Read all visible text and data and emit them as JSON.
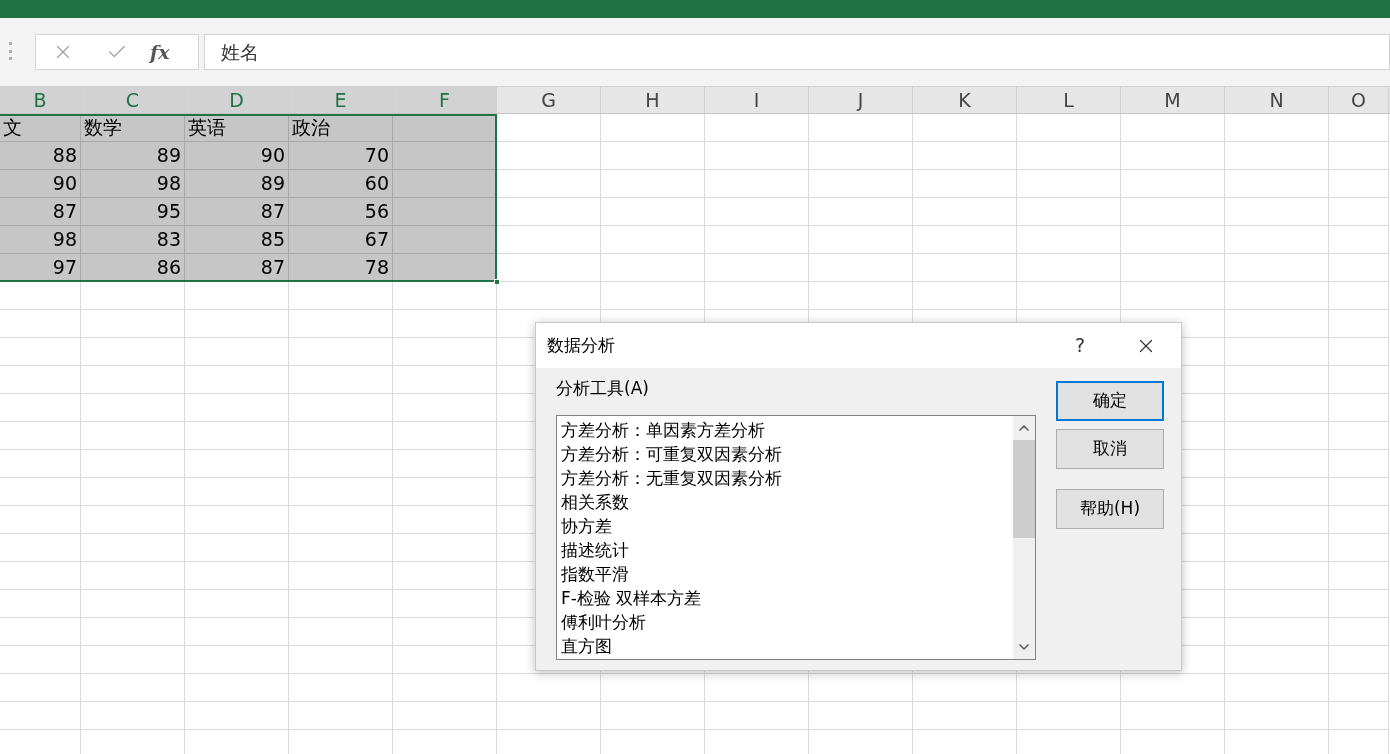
{
  "formula_bar": {
    "fx_label": "fx",
    "value": "姓名"
  },
  "sheet": {
    "columns": [
      {
        "label": "B",
        "selected": true
      },
      {
        "label": "C",
        "selected": true
      },
      {
        "label": "D",
        "selected": true
      },
      {
        "label": "E",
        "selected": true
      },
      {
        "label": "F",
        "selected": true
      },
      {
        "label": "G",
        "selected": false
      },
      {
        "label": "H",
        "selected": false
      },
      {
        "label": "I",
        "selected": false
      },
      {
        "label": "J",
        "selected": false
      },
      {
        "label": "K",
        "selected": false
      },
      {
        "label": "L",
        "selected": false
      },
      {
        "label": "M",
        "selected": false
      },
      {
        "label": "N",
        "selected": false
      },
      {
        "label": "O",
        "selected": false
      }
    ],
    "rows": [
      {
        "kind": "text",
        "selected": true,
        "cells": [
          "文",
          "数学",
          "英语",
          "政治"
        ]
      },
      {
        "kind": "number",
        "selected": true,
        "cells": [
          "88",
          "89",
          "90",
          "70"
        ]
      },
      {
        "kind": "number",
        "selected": true,
        "cells": [
          "90",
          "98",
          "89",
          "60"
        ]
      },
      {
        "kind": "number",
        "selected": true,
        "cells": [
          "87",
          "95",
          "87",
          "56"
        ]
      },
      {
        "kind": "number",
        "selected": true,
        "cells": [
          "98",
          "83",
          "85",
          "67"
        ]
      },
      {
        "kind": "number",
        "selected": true,
        "cells": [
          "97",
          "86",
          "87",
          "78"
        ]
      }
    ]
  },
  "dialog": {
    "title": "数据分析",
    "help": "?",
    "list_label": "分析工具(A)",
    "items": [
      {
        "label": "方差分析：单因素方差分析",
        "selected": false
      },
      {
        "label": "方差分析：可重复双因素分析",
        "selected": false
      },
      {
        "label": "方差分析：无重复双因素分析",
        "selected": false
      },
      {
        "label": "相关系数",
        "selected": false
      },
      {
        "label": "协方差",
        "selected": false
      },
      {
        "label": "描述统计",
        "selected": false
      },
      {
        "label": "指数平滑",
        "selected": false
      },
      {
        "label": "F-检验 双样本方差",
        "selected": false
      },
      {
        "label": "傅利叶分析",
        "selected": false
      },
      {
        "label": "直方图",
        "selected": false
      }
    ],
    "buttons": [
      {
        "label": "确定",
        "default": true
      },
      {
        "label": "取消",
        "default": false
      },
      {
        "label": "帮助(H)",
        "default": false
      }
    ]
  }
}
